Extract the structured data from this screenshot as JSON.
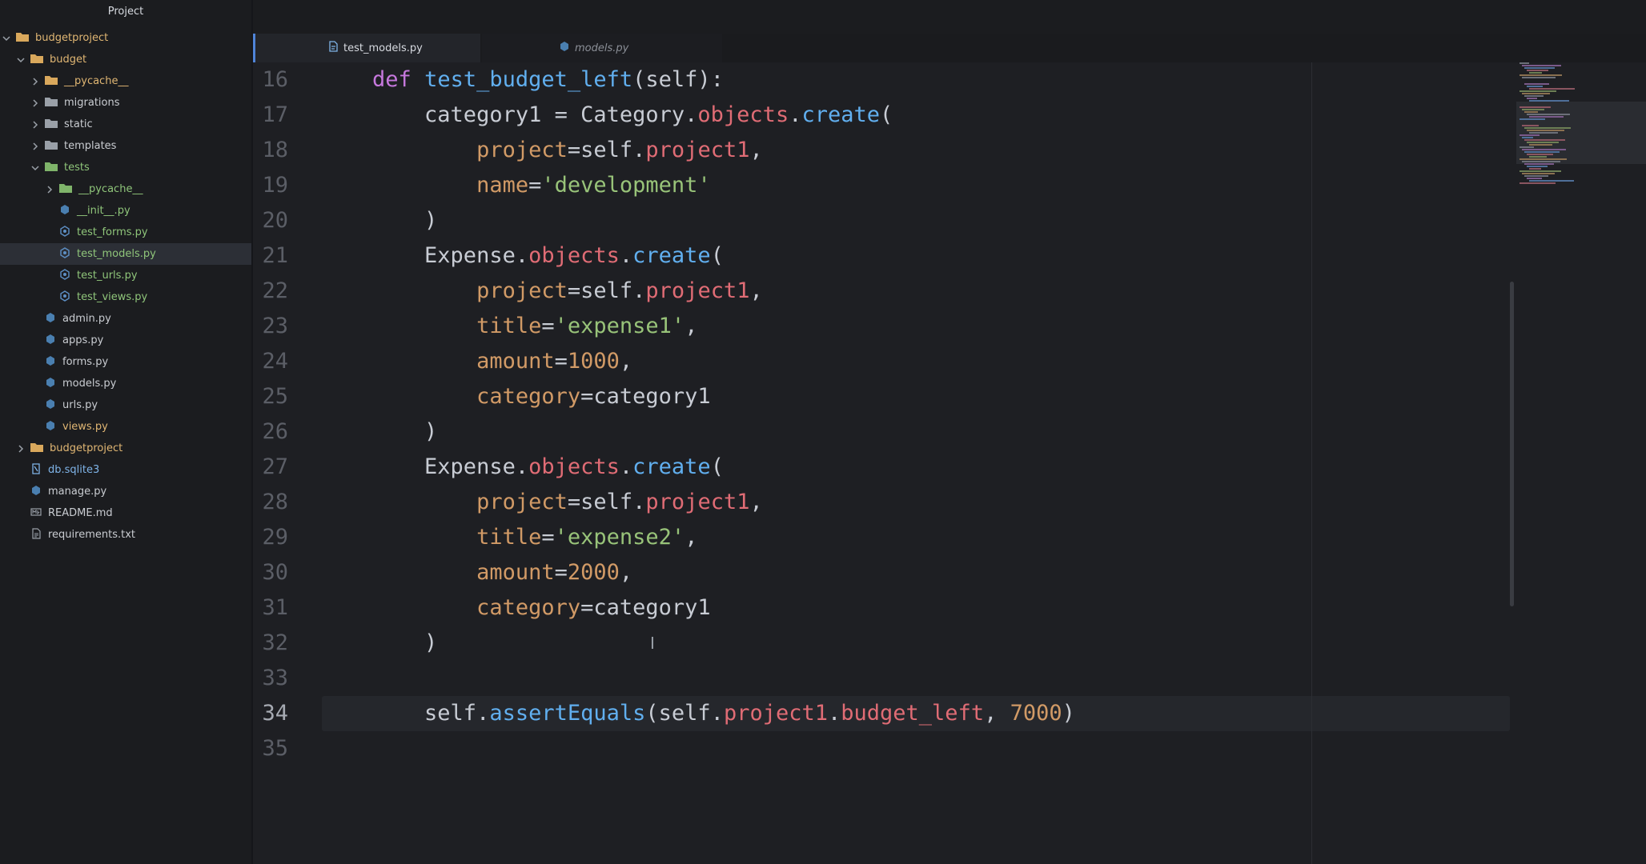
{
  "sidebar": {
    "title": "Project",
    "tree": [
      {
        "label": "budgetproject",
        "type": "folder",
        "open": true,
        "depth": 0,
        "color": "orange"
      },
      {
        "label": "budget",
        "type": "folder",
        "open": true,
        "depth": 1,
        "color": "orange"
      },
      {
        "label": "__pycache__",
        "type": "folder",
        "open": false,
        "depth": 2,
        "color": "orange"
      },
      {
        "label": "migrations",
        "type": "folder",
        "open": false,
        "depth": 2,
        "color": "default"
      },
      {
        "label": "static",
        "type": "folder",
        "open": false,
        "depth": 2,
        "color": "default"
      },
      {
        "label": "templates",
        "type": "folder",
        "open": false,
        "depth": 2,
        "color": "default"
      },
      {
        "label": "tests",
        "type": "folder",
        "open": true,
        "depth": 2,
        "color": "green"
      },
      {
        "label": "__pycache__",
        "type": "folder",
        "open": false,
        "depth": 3,
        "color": "green"
      },
      {
        "label": "__init__.py",
        "type": "py",
        "depth": 3,
        "color": "green"
      },
      {
        "label": "test_forms.py",
        "type": "test",
        "depth": 3,
        "color": "green"
      },
      {
        "label": "test_models.py",
        "type": "test",
        "depth": 3,
        "color": "green",
        "selected": true
      },
      {
        "label": "test_urls.py",
        "type": "test",
        "depth": 3,
        "color": "green"
      },
      {
        "label": "test_views.py",
        "type": "test",
        "depth": 3,
        "color": "green"
      },
      {
        "label": "admin.py",
        "type": "py",
        "depth": 2,
        "color": "default"
      },
      {
        "label": "apps.py",
        "type": "py",
        "depth": 2,
        "color": "default"
      },
      {
        "label": "forms.py",
        "type": "py",
        "depth": 2,
        "color": "default"
      },
      {
        "label": "models.py",
        "type": "py",
        "depth": 2,
        "color": "default"
      },
      {
        "label": "urls.py",
        "type": "py",
        "depth": 2,
        "color": "default"
      },
      {
        "label": "views.py",
        "type": "py",
        "depth": 2,
        "color": "orange"
      },
      {
        "label": "budgetproject",
        "type": "folder",
        "open": false,
        "depth": 1,
        "color": "orange"
      },
      {
        "label": "db.sqlite3",
        "type": "db",
        "depth": 1,
        "color": "blue"
      },
      {
        "label": "manage.py",
        "type": "py",
        "depth": 1,
        "color": "default"
      },
      {
        "label": "README.md",
        "type": "md",
        "depth": 1,
        "color": "default"
      },
      {
        "label": "requirements.txt",
        "type": "txt",
        "depth": 1,
        "color": "default"
      }
    ]
  },
  "tabs": [
    {
      "label": "test_models.py",
      "active": true
    },
    {
      "label": "models.py",
      "active": false
    }
  ],
  "editor": {
    "current_line": 34,
    "lines": [
      {
        "n": 16,
        "tokens": [
          [
            "plain",
            "    "
          ],
          [
            "kw",
            "def "
          ],
          [
            "fn",
            "test_budget_left"
          ],
          [
            "plain",
            "(self):"
          ]
        ]
      },
      {
        "n": 17,
        "tokens": [
          [
            "plain",
            "        category1 = Category."
          ],
          [
            "prop",
            "objects"
          ],
          [
            "plain",
            "."
          ],
          [
            "fn",
            "create"
          ],
          [
            "plain",
            "("
          ]
        ]
      },
      {
        "n": 18,
        "tokens": [
          [
            "plain",
            "            "
          ],
          [
            "arg",
            "project"
          ],
          [
            "plain",
            "=self."
          ],
          [
            "prop",
            "project1"
          ],
          [
            "plain",
            ","
          ]
        ]
      },
      {
        "n": 19,
        "tokens": [
          [
            "plain",
            "            "
          ],
          [
            "arg",
            "name"
          ],
          [
            "plain",
            "="
          ],
          [
            "str",
            "'development'"
          ]
        ]
      },
      {
        "n": 20,
        "tokens": [
          [
            "plain",
            "        )"
          ]
        ]
      },
      {
        "n": 21,
        "tokens": [
          [
            "plain",
            "        Expense."
          ],
          [
            "prop",
            "objects"
          ],
          [
            "plain",
            "."
          ],
          [
            "fn",
            "create"
          ],
          [
            "plain",
            "("
          ]
        ]
      },
      {
        "n": 22,
        "tokens": [
          [
            "plain",
            "            "
          ],
          [
            "arg",
            "project"
          ],
          [
            "plain",
            "=self."
          ],
          [
            "prop",
            "project1"
          ],
          [
            "plain",
            ","
          ]
        ]
      },
      {
        "n": 23,
        "tokens": [
          [
            "plain",
            "            "
          ],
          [
            "arg",
            "title"
          ],
          [
            "plain",
            "="
          ],
          [
            "str",
            "'expense1'"
          ],
          [
            "plain",
            ","
          ]
        ]
      },
      {
        "n": 24,
        "tokens": [
          [
            "plain",
            "            "
          ],
          [
            "arg",
            "amount"
          ],
          [
            "plain",
            "="
          ],
          [
            "num",
            "1000"
          ],
          [
            "plain",
            ","
          ]
        ]
      },
      {
        "n": 25,
        "tokens": [
          [
            "plain",
            "            "
          ],
          [
            "arg",
            "category"
          ],
          [
            "plain",
            "=category1"
          ]
        ]
      },
      {
        "n": 26,
        "tokens": [
          [
            "plain",
            "        )"
          ]
        ]
      },
      {
        "n": 27,
        "tokens": [
          [
            "plain",
            "        Expense."
          ],
          [
            "prop",
            "objects"
          ],
          [
            "plain",
            "."
          ],
          [
            "fn",
            "create"
          ],
          [
            "plain",
            "("
          ]
        ]
      },
      {
        "n": 28,
        "tokens": [
          [
            "plain",
            "            "
          ],
          [
            "arg",
            "project"
          ],
          [
            "plain",
            "=self."
          ],
          [
            "prop",
            "project1"
          ],
          [
            "plain",
            ","
          ]
        ]
      },
      {
        "n": 29,
        "tokens": [
          [
            "plain",
            "            "
          ],
          [
            "arg",
            "title"
          ],
          [
            "plain",
            "="
          ],
          [
            "str",
            "'expense2'"
          ],
          [
            "plain",
            ","
          ]
        ]
      },
      {
        "n": 30,
        "tokens": [
          [
            "plain",
            "            "
          ],
          [
            "arg",
            "amount"
          ],
          [
            "plain",
            "="
          ],
          [
            "num",
            "2000"
          ],
          [
            "plain",
            ","
          ]
        ]
      },
      {
        "n": 31,
        "tokens": [
          [
            "plain",
            "            "
          ],
          [
            "arg",
            "category"
          ],
          [
            "plain",
            "=category1"
          ]
        ]
      },
      {
        "n": 32,
        "tokens": [
          [
            "plain",
            "        )"
          ]
        ]
      },
      {
        "n": 33,
        "tokens": []
      },
      {
        "n": 34,
        "tokens": [
          [
            "plain",
            "        self."
          ],
          [
            "fn",
            "assertEquals"
          ],
          [
            "plain",
            "(self."
          ],
          [
            "prop",
            "project1"
          ],
          [
            "plain",
            "."
          ],
          [
            "prop",
            "budget_left"
          ],
          [
            "plain",
            ", "
          ],
          [
            "num",
            "7000"
          ],
          [
            "plain",
            ")"
          ]
        ]
      },
      {
        "n": 35,
        "tokens": []
      }
    ]
  }
}
